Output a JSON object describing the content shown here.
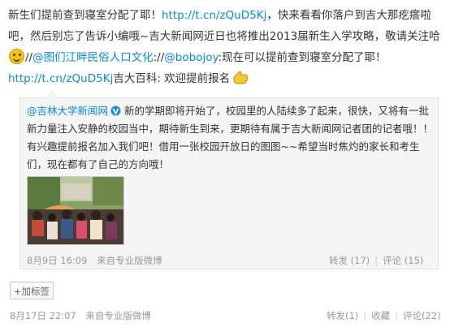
{
  "post": {
    "seg1": "新生们提前查到寝室分配了耶！",
    "link1": "http://t.cn/zQuD5Kj",
    "seg2": "，快来看看你落户到吉大那疙瘩啦吧，然后别忘了告诉小编哦~吉大新闻网近日也将推出2013届新生入学攻略，敬请关注哈",
    "seg3": "//",
    "mention1": "@图们江畔民俗人口文化",
    "seg4": ":",
    "seg5": "//",
    "mention2": "@bobojoy",
    "seg6": ":现在可以提前查到寝室分配了耶！",
    "link2": "http://t.cn/zQuD5Kj",
    "seg7": "吉大百科: 欢迎提前报名",
    "emoji_icon": "smiley-emoji-icon",
    "hand_icon": "hand-point-icon"
  },
  "quote": {
    "author": "@吉林大学新闻网",
    "body": "新的学期即将开始了，校园里的人陆续多了起来，很快，又将有一批新力量注入安静的校园当中，期待新生到来，更期待有属于吉大新闻网记者团的记者哦！！有兴趣提前报名加入我们吧！借用一张校园开放日的图图~~希望当时焦灼的家长和考生们，现在都有了自己的方向哦！",
    "time": "8月9日 16:09",
    "source_prefix": "来自",
    "source": "专业版微博",
    "repost_label": "转发",
    "repost_count": "(17)",
    "comment_label": "评论",
    "comment_count": "(15)",
    "sep": "|"
  },
  "tag_button": "+加标签",
  "footer": {
    "time": "8月17日 22:07",
    "source_prefix": "来自",
    "source": "专业版微博",
    "repost_label": "转发",
    "repost_count": "(1)",
    "fav_label": "收藏",
    "comment_label": "评论",
    "comment_count": "(22)",
    "sep": "|"
  },
  "colors": {
    "link": "#0a8cd2",
    "meta": "#999999",
    "quote_bg": "#f5f5f5"
  }
}
